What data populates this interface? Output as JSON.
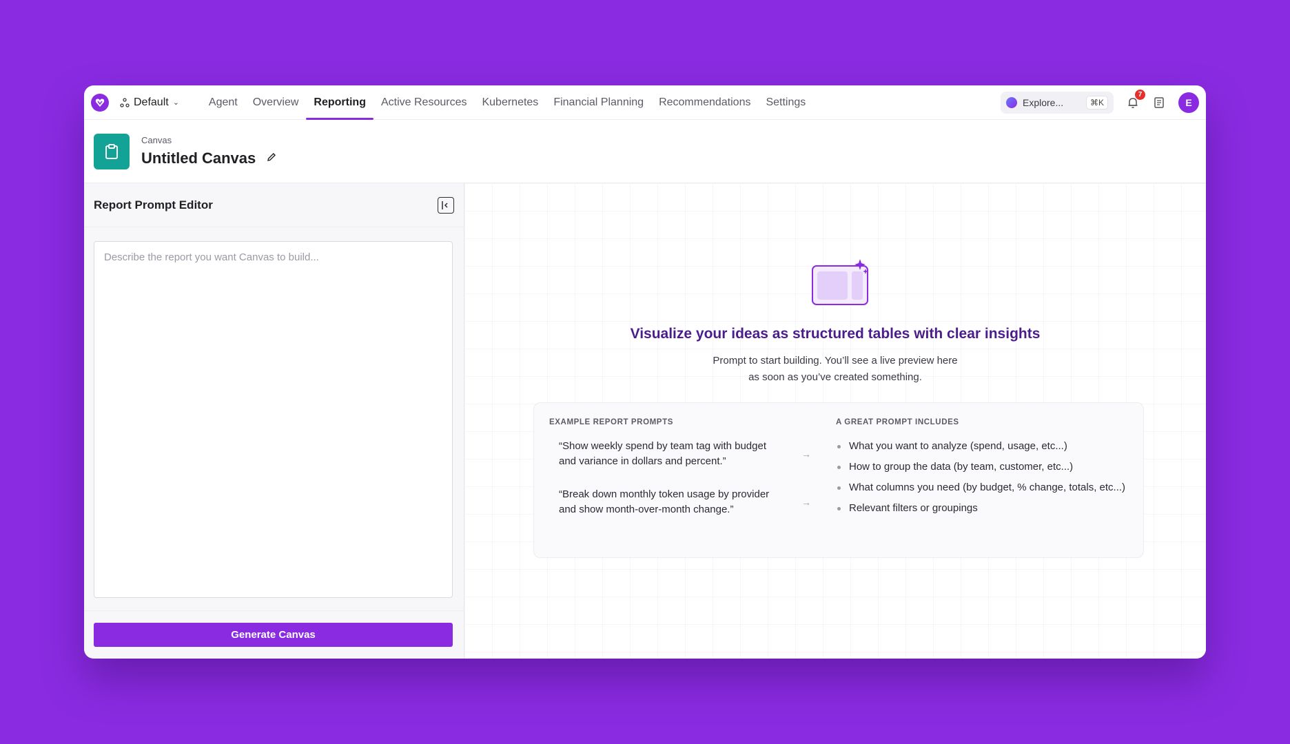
{
  "topnav": {
    "workspace": "Default",
    "tabs": [
      {
        "label": "Agent"
      },
      {
        "label": "Overview"
      },
      {
        "label": "Reporting"
      },
      {
        "label": "Active Resources"
      },
      {
        "label": "Kubernetes"
      },
      {
        "label": "Financial Planning"
      },
      {
        "label": "Recommendations"
      },
      {
        "label": "Settings"
      }
    ],
    "active_tab": "Reporting",
    "explore": {
      "label": "Explore...",
      "shortcut": "⌘K"
    },
    "notifications_count": "7",
    "avatar_initial": "E"
  },
  "page": {
    "breadcrumb": "Canvas",
    "title": "Untitled Canvas"
  },
  "editor": {
    "title": "Report Prompt Editor",
    "placeholder": "Describe the report you want Canvas to build...",
    "value": "",
    "generate_label": "Generate Canvas"
  },
  "preview": {
    "heading": "Visualize your ideas as structured tables with clear insights",
    "sub_line1": "Prompt to start building. You’ll see a live preview here",
    "sub_line2": "as soon as you’ve created something.",
    "examples_heading": "EXAMPLE REPORT PROMPTS",
    "examples": [
      {
        "text": "“Show weekly spend by team tag with budget and variance in dollars and percent.”"
      },
      {
        "text": "“Break down monthly token usage by provider and show month-over-month change.”"
      }
    ],
    "tips_heading": "A GREAT PROMPT INCLUDES",
    "tips": [
      {
        "text": "What you want to analyze (spend, usage, etc...)"
      },
      {
        "text": "How to group the data (by team, customer, etc...)"
      },
      {
        "text": "What columns you need (by budget, % change, totals, etc...)"
      },
      {
        "text": "Relevant filters or groupings"
      }
    ]
  },
  "colors": {
    "accent": "#8a2be2",
    "canvas_tile": "#13a396",
    "heading": "#4b1d8c",
    "badge": "#e5312d"
  }
}
